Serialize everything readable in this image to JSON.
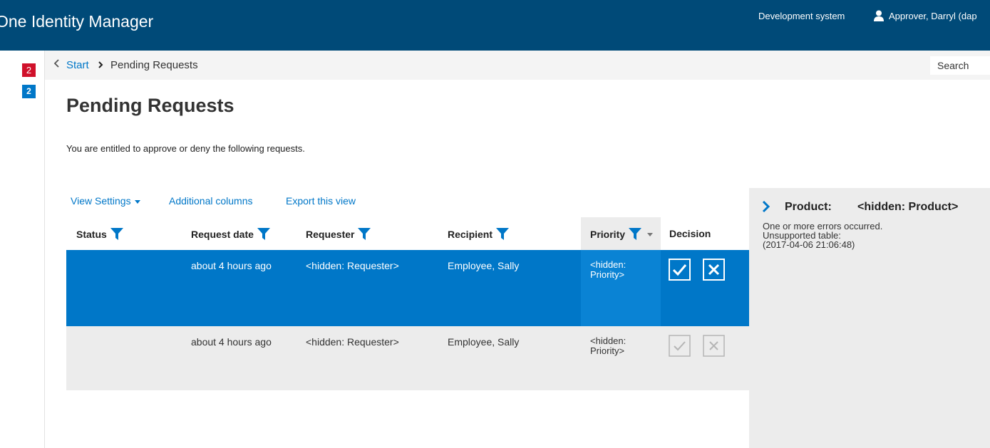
{
  "header": {
    "app_title": "One Identity Manager",
    "environment": "Development system",
    "user": "Approver, Darryl (dap"
  },
  "rail": {
    "badge_red": "2",
    "badge_blue": "2"
  },
  "breadcrumb": {
    "start": "Start",
    "current": "Pending Requests"
  },
  "search": {
    "placeholder": "Search"
  },
  "page": {
    "title": "Pending Requests",
    "intro": "You are entitled to approve or deny the following requests."
  },
  "toolbar": {
    "view_settings": "View Settings",
    "additional_columns": "Additional columns",
    "export_view": "Export this view"
  },
  "table": {
    "columns": [
      "Status",
      "Request date",
      "Requester",
      "Recipient",
      "Priority",
      "Decision"
    ],
    "rows": [
      {
        "status": "",
        "request_date": "about 4 hours ago",
        "requester": "<hidden: Requester>",
        "recipient": "Employee, Sally",
        "priority": "<hidden: Priority>",
        "selected": true
      },
      {
        "status": "",
        "request_date": "about 4 hours ago",
        "requester": "<hidden: Requester>",
        "recipient": "Employee, Sally",
        "priority": "<hidden: Priority>",
        "selected": false
      }
    ]
  },
  "panel": {
    "product_label": "Product:",
    "product_value": "<hidden: Product>",
    "messages": [
      "One or more errors occurred.",
      "Unsupported table:",
      "(2017-04-06 21:06:48)"
    ]
  },
  "colors": {
    "topbar": "#004a78",
    "accent": "#0077c8",
    "badge_red": "#d0112b"
  },
  "icons": {
    "column_filter": "funnel-icon",
    "approve": "checkmark-box-icon",
    "deny": "x-box-icon",
    "user": "user-icon",
    "panel_toggle": "chevron-right-icon",
    "back": "chevron-left-icon"
  }
}
